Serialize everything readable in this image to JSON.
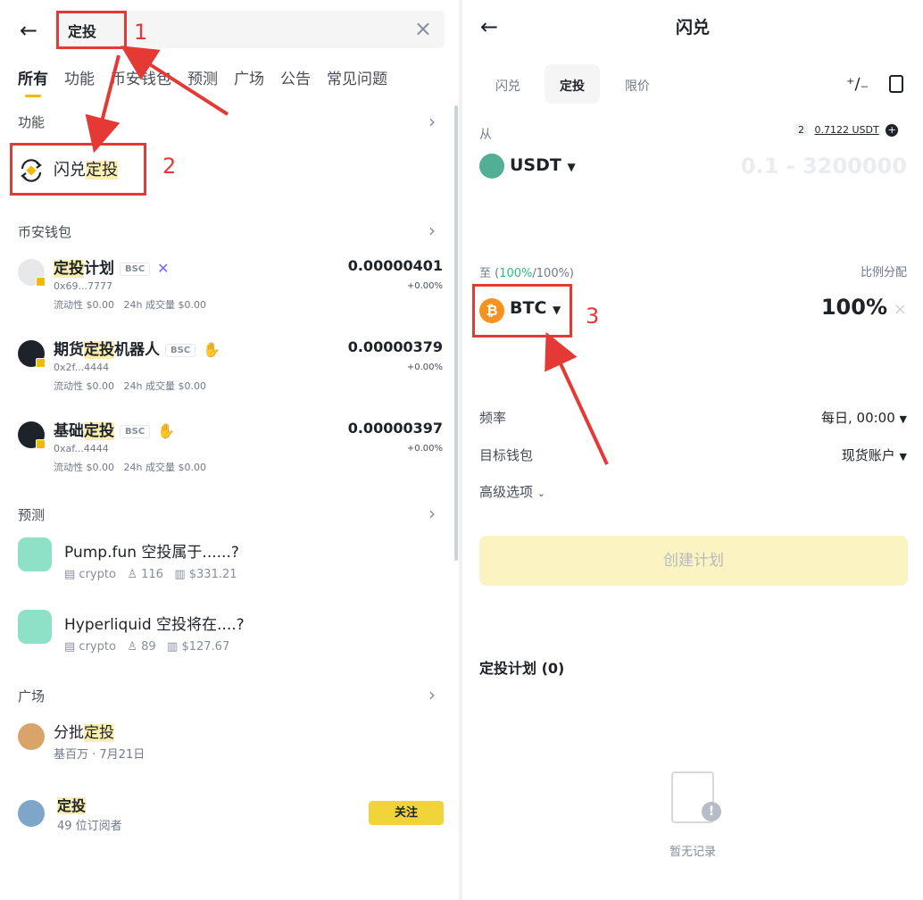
{
  "left": {
    "search": {
      "value": "定投"
    },
    "tabs": [
      "所有",
      "功能",
      "币安钱包",
      "预测",
      "广场",
      "公告",
      "常见问题"
    ],
    "sections": {
      "function": "功能",
      "wallet": "币安钱包",
      "prediction": "预测",
      "square": "广场"
    },
    "function_item": {
      "prefix": "闪兑",
      "highlight": "定投"
    },
    "tokens": [
      {
        "name_hl": "定投",
        "name_rest": "计划",
        "chain": "BSC",
        "address": "0x69...7777",
        "liquidity": "流动性 $0.00",
        "volume": "24h 成交量 $0.00",
        "price": "0.00000401",
        "change": "+0.00%"
      },
      {
        "name_pre": "期货",
        "name_hl": "定投",
        "name_rest": "机器人",
        "chain": "BSC",
        "address": "0x2f...4444",
        "liquidity": "流动性 $0.00",
        "volume": "24h 成交量 $0.00",
        "price": "0.00000379",
        "change": "+0.00%"
      },
      {
        "name_pre": "基础",
        "name_hl": "定投",
        "name_rest": "",
        "chain": "BSC",
        "address": "0xaf...4444",
        "liquidity": "流动性 $0.00",
        "volume": "24h 成交量 $0.00",
        "price": "0.00000397",
        "change": "+0.00%"
      }
    ],
    "predictions": [
      {
        "title": "Pump.fun 空投属于......?",
        "tag": "crypto",
        "users": "116",
        "volume": "$331.21"
      },
      {
        "title": "Hyperliquid 空投将在....?",
        "tag": "crypto",
        "users": "89",
        "volume": "$127.67"
      }
    ],
    "square_post": {
      "prefix": "分批",
      "highlight": "定投",
      "meta": "基百万 · 7月21日"
    },
    "topic": {
      "name": "定投",
      "subscribers": "49 位订阅者",
      "follow": "关注"
    }
  },
  "right": {
    "title": "闪兑",
    "segments": [
      "闪兑",
      "定投",
      "限价"
    ],
    "from_label": "从",
    "balance_count": "2",
    "balance": "0.7122 USDT",
    "from_coin": "USDT",
    "amount_placeholder": "0.1 - 3200000",
    "to_label_pre": "至 (",
    "to_pct_a": "100%",
    "to_label_mid": "/100%)",
    "ratio_label": "比例分配",
    "to_coin": "BTC",
    "to_pct": "100%",
    "freq_label": "频率",
    "freq_value": "每日, 00:00",
    "wallet_label": "目标钱包",
    "wallet_value": "现货账户",
    "advanced": "高级选项",
    "create": "创建计划",
    "plans_title": "定投计划 (0)",
    "empty": "暂无记录"
  },
  "annotations": [
    "1",
    "2",
    "3"
  ],
  "colors": {
    "accent": "#f0b90b",
    "annotation": "#e53935",
    "green": "#2ebd85"
  }
}
